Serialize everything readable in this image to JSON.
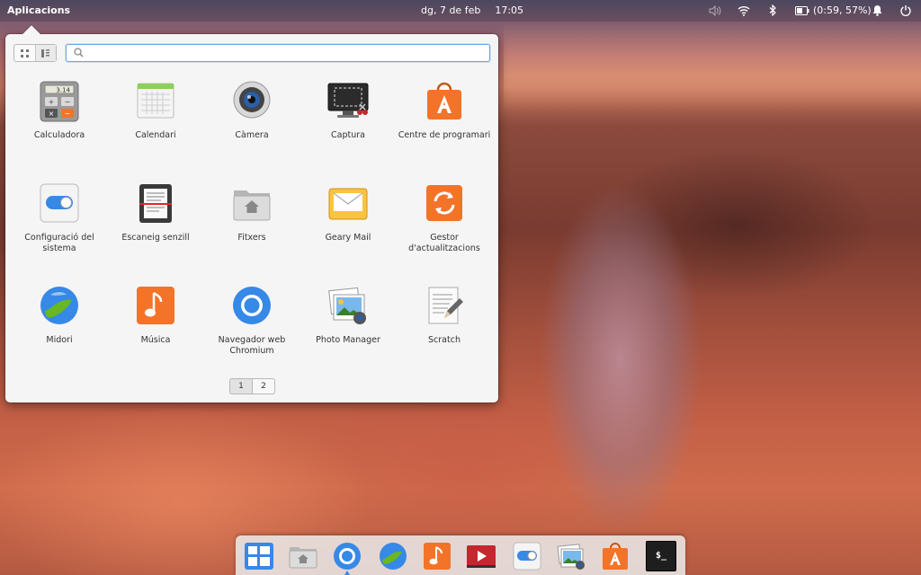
{
  "panel": {
    "applications_label": "Aplicacions",
    "date": "dg, 7 de feb",
    "time": "17:05",
    "battery": "(0:59, 57%)",
    "icons": [
      "volume-icon",
      "wifi-icon",
      "bluetooth-icon",
      "battery-icon",
      "notifications-icon",
      "power-icon"
    ]
  },
  "launcher": {
    "search_value": "",
    "search_placeholder": "",
    "view_modes": [
      "grid-view-icon",
      "category-view-icon"
    ],
    "apps": [
      {
        "label": "Calculadora",
        "icon": "calculator-icon"
      },
      {
        "label": "Calendari",
        "icon": "calendar-icon"
      },
      {
        "label": "Càmera",
        "icon": "camera-icon"
      },
      {
        "label": "Captura",
        "icon": "screenshot-icon"
      },
      {
        "label": "Centre de programari",
        "icon": "software-center-icon"
      },
      {
        "label": "Configuració del sistema",
        "icon": "system-settings-icon"
      },
      {
        "label": "Escaneig senzill",
        "icon": "scanner-icon"
      },
      {
        "label": "Fitxers",
        "icon": "files-icon"
      },
      {
        "label": "Geary Mail",
        "icon": "mail-icon"
      },
      {
        "label": "Gestor d'actualitzacions",
        "icon": "update-manager-icon"
      },
      {
        "label": "Midori",
        "icon": "midori-icon"
      },
      {
        "label": "Música",
        "icon": "music-icon"
      },
      {
        "label": "Navegador web Chromium",
        "icon": "chromium-icon"
      },
      {
        "label": "Photo Manager",
        "icon": "photo-manager-icon"
      },
      {
        "label": "Scratch",
        "icon": "scratch-icon"
      }
    ],
    "pages": [
      "1",
      "2"
    ],
    "active_page": "1"
  },
  "dock": {
    "items": [
      "multitasking-view-icon",
      "files-icon",
      "chromium-icon",
      "midori-icon",
      "music-icon",
      "videos-icon",
      "system-settings-icon",
      "photo-manager-icon",
      "software-center-icon",
      "terminal-icon"
    ],
    "terminal_prompt": "$_"
  },
  "colors": {
    "accent": "#3689e6",
    "orange": "#f37329",
    "popover_bg": "#f5f5f5"
  }
}
